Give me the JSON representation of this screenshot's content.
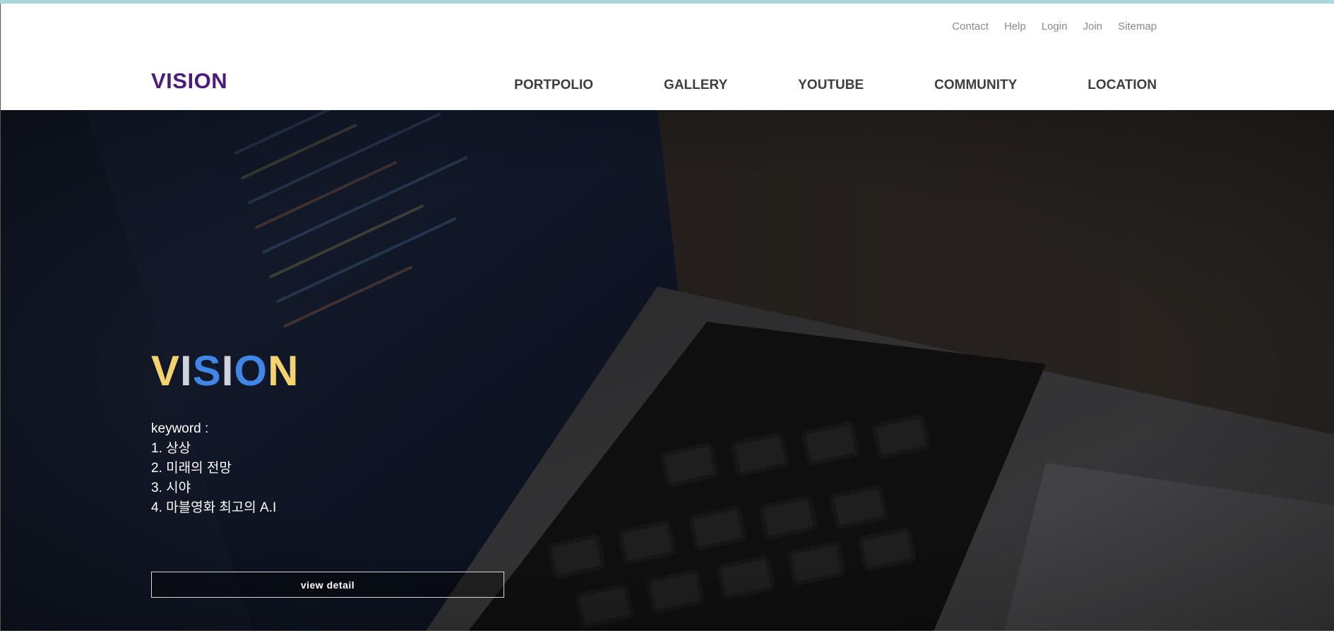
{
  "util_nav": [
    "Contact",
    "Help",
    "Login",
    "Join",
    "Sitemap"
  ],
  "logo": "VISION",
  "main_nav": [
    "PORTPOLIO",
    "GALLERY",
    "YOUTUBE",
    "COMMUNITY",
    "LOCATION"
  ],
  "hero": {
    "title_letters": [
      {
        "ch": "V",
        "color": "#f5d36a"
      },
      {
        "ch": "I",
        "color": "#cfd2d8"
      },
      {
        "ch": "S",
        "color": "#3f86e6"
      },
      {
        "ch": "I",
        "color": "#cfd2d8"
      },
      {
        "ch": "O",
        "color": "#3f86e6"
      },
      {
        "ch": "N",
        "color": "#f5d36a"
      }
    ],
    "keyword_heading": "keyword :",
    "keywords": [
      "1. 상상",
      "2. 미래의 전망",
      "3. 시야",
      "4. 마블영화 최고의 A.I"
    ],
    "button_label": "view detail"
  },
  "colors": {
    "logo": "#4b1a7e",
    "top_bar": "#a8d8dc",
    "nav_text": "#3e3e3e",
    "util_text": "#8a8a8a"
  }
}
